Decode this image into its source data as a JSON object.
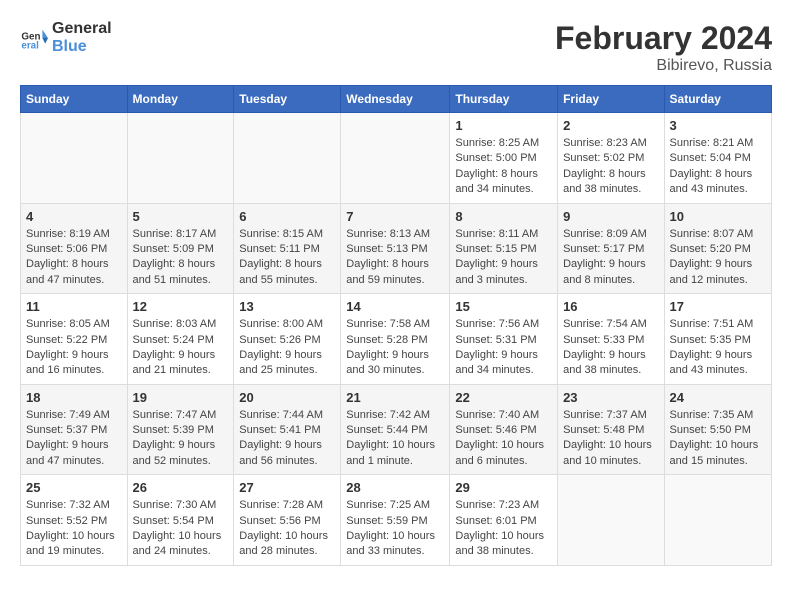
{
  "header": {
    "logo_line1": "General",
    "logo_line2": "Blue",
    "title": "February 2024",
    "subtitle": "Bibirevo, Russia"
  },
  "days_of_week": [
    "Sunday",
    "Monday",
    "Tuesday",
    "Wednesday",
    "Thursday",
    "Friday",
    "Saturday"
  ],
  "weeks": [
    [
      {
        "day": "",
        "info": ""
      },
      {
        "day": "",
        "info": ""
      },
      {
        "day": "",
        "info": ""
      },
      {
        "day": "",
        "info": ""
      },
      {
        "day": "1",
        "info": "Sunrise: 8:25 AM\nSunset: 5:00 PM\nDaylight: 8 hours and 34 minutes."
      },
      {
        "day": "2",
        "info": "Sunrise: 8:23 AM\nSunset: 5:02 PM\nDaylight: 8 hours and 38 minutes."
      },
      {
        "day": "3",
        "info": "Sunrise: 8:21 AM\nSunset: 5:04 PM\nDaylight: 8 hours and 43 minutes."
      }
    ],
    [
      {
        "day": "4",
        "info": "Sunrise: 8:19 AM\nSunset: 5:06 PM\nDaylight: 8 hours and 47 minutes."
      },
      {
        "day": "5",
        "info": "Sunrise: 8:17 AM\nSunset: 5:09 PM\nDaylight: 8 hours and 51 minutes."
      },
      {
        "day": "6",
        "info": "Sunrise: 8:15 AM\nSunset: 5:11 PM\nDaylight: 8 hours and 55 minutes."
      },
      {
        "day": "7",
        "info": "Sunrise: 8:13 AM\nSunset: 5:13 PM\nDaylight: 8 hours and 59 minutes."
      },
      {
        "day": "8",
        "info": "Sunrise: 8:11 AM\nSunset: 5:15 PM\nDaylight: 9 hours and 3 minutes."
      },
      {
        "day": "9",
        "info": "Sunrise: 8:09 AM\nSunset: 5:17 PM\nDaylight: 9 hours and 8 minutes."
      },
      {
        "day": "10",
        "info": "Sunrise: 8:07 AM\nSunset: 5:20 PM\nDaylight: 9 hours and 12 minutes."
      }
    ],
    [
      {
        "day": "11",
        "info": "Sunrise: 8:05 AM\nSunset: 5:22 PM\nDaylight: 9 hours and 16 minutes."
      },
      {
        "day": "12",
        "info": "Sunrise: 8:03 AM\nSunset: 5:24 PM\nDaylight: 9 hours and 21 minutes."
      },
      {
        "day": "13",
        "info": "Sunrise: 8:00 AM\nSunset: 5:26 PM\nDaylight: 9 hours and 25 minutes."
      },
      {
        "day": "14",
        "info": "Sunrise: 7:58 AM\nSunset: 5:28 PM\nDaylight: 9 hours and 30 minutes."
      },
      {
        "day": "15",
        "info": "Sunrise: 7:56 AM\nSunset: 5:31 PM\nDaylight: 9 hours and 34 minutes."
      },
      {
        "day": "16",
        "info": "Sunrise: 7:54 AM\nSunset: 5:33 PM\nDaylight: 9 hours and 38 minutes."
      },
      {
        "day": "17",
        "info": "Sunrise: 7:51 AM\nSunset: 5:35 PM\nDaylight: 9 hours and 43 minutes."
      }
    ],
    [
      {
        "day": "18",
        "info": "Sunrise: 7:49 AM\nSunset: 5:37 PM\nDaylight: 9 hours and 47 minutes."
      },
      {
        "day": "19",
        "info": "Sunrise: 7:47 AM\nSunset: 5:39 PM\nDaylight: 9 hours and 52 minutes."
      },
      {
        "day": "20",
        "info": "Sunrise: 7:44 AM\nSunset: 5:41 PM\nDaylight: 9 hours and 56 minutes."
      },
      {
        "day": "21",
        "info": "Sunrise: 7:42 AM\nSunset: 5:44 PM\nDaylight: 10 hours and 1 minute."
      },
      {
        "day": "22",
        "info": "Sunrise: 7:40 AM\nSunset: 5:46 PM\nDaylight: 10 hours and 6 minutes."
      },
      {
        "day": "23",
        "info": "Sunrise: 7:37 AM\nSunset: 5:48 PM\nDaylight: 10 hours and 10 minutes."
      },
      {
        "day": "24",
        "info": "Sunrise: 7:35 AM\nSunset: 5:50 PM\nDaylight: 10 hours and 15 minutes."
      }
    ],
    [
      {
        "day": "25",
        "info": "Sunrise: 7:32 AM\nSunset: 5:52 PM\nDaylight: 10 hours and 19 minutes."
      },
      {
        "day": "26",
        "info": "Sunrise: 7:30 AM\nSunset: 5:54 PM\nDaylight: 10 hours and 24 minutes."
      },
      {
        "day": "27",
        "info": "Sunrise: 7:28 AM\nSunset: 5:56 PM\nDaylight: 10 hours and 28 minutes."
      },
      {
        "day": "28",
        "info": "Sunrise: 7:25 AM\nSunset: 5:59 PM\nDaylight: 10 hours and 33 minutes."
      },
      {
        "day": "29",
        "info": "Sunrise: 7:23 AM\nSunset: 6:01 PM\nDaylight: 10 hours and 38 minutes."
      },
      {
        "day": "",
        "info": ""
      },
      {
        "day": "",
        "info": ""
      }
    ]
  ]
}
